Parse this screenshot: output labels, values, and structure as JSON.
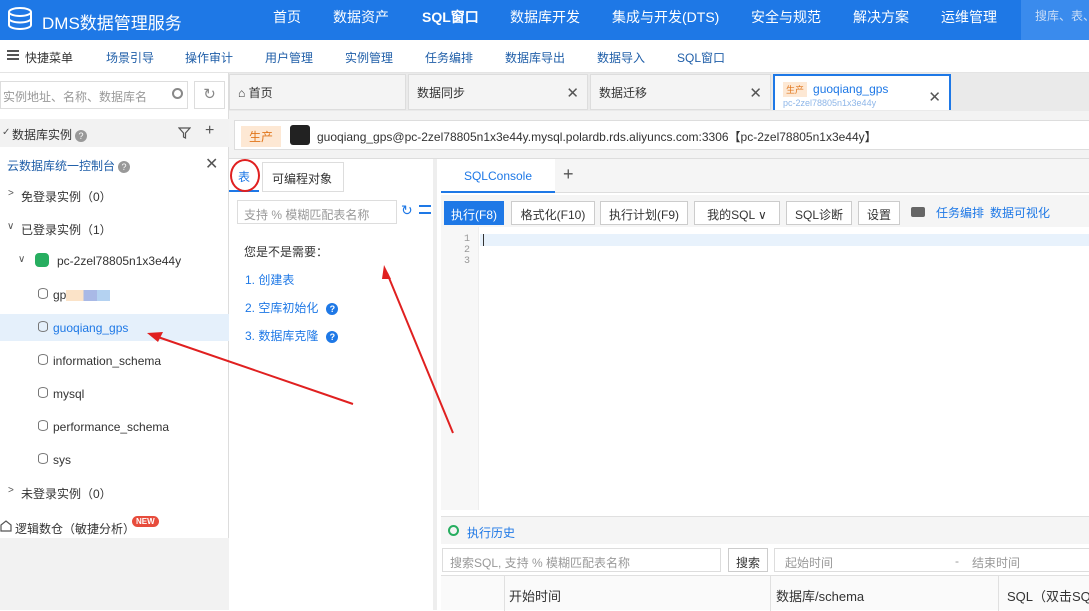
{
  "app": {
    "title": "DMS数据管理服务"
  },
  "topnav": {
    "items": [
      "首页",
      "数据资产",
      "SQL窗口",
      "数据库开发",
      "集成与开发(DTS)",
      "安全与规范",
      "解决方案",
      "运维管理"
    ],
    "active": "SQL窗口",
    "search_placeholder": "搜库、表、列"
  },
  "quickbar": {
    "label": "快捷菜单",
    "items": [
      "场景引导",
      "操作审计",
      "用户管理",
      "实例管理",
      "任务编排",
      "数据库导出",
      "数据导入",
      "SQL窗口"
    ]
  },
  "left": {
    "search_placeholder": "实例地址、名称、数据库名",
    "db_instances_label": "数据库实例",
    "console_link": "云数据库统一控制台",
    "no_login_group": "免登录实例（0）",
    "logged_group": "已登录实例（1）",
    "instance_name": "pc-2zel78805n1x3e44y",
    "databases": [
      "gp",
      "guoqiang_gps",
      "information_schema",
      "mysql",
      "performance_schema",
      "sys"
    ],
    "unlogged_group": "未登录实例（0）",
    "logic_db_label": "逻辑数仓（敏捷分析）",
    "new_badge": "NEW"
  },
  "tabs": [
    {
      "label": "首页"
    },
    {
      "label": "数据同步"
    },
    {
      "label": "数据迁移"
    },
    {
      "env": "生产",
      "label": "guoqiang_gps",
      "sub": "pc-2zel78805n1x3e44y"
    }
  ],
  "connection": {
    "env": "生产",
    "text": "guoqiang_gps@pc-2zel78805n1x3e44y.mysql.polardb.rds.aliyuncs.com:3306【pc-2zel78805n1x3e44y】"
  },
  "objects": {
    "tab_table": "表",
    "tab_programmable": "可编程对象",
    "search_placeholder": "支持 % 模糊匹配表名称",
    "suggest_title": "您是不是需要：",
    "suggestions": [
      "1. 创建表",
      "2. 空库初始化",
      "3. 数据库克隆"
    ]
  },
  "console": {
    "tab": "SQLConsole",
    "buttons": {
      "execute": "执行(F8)",
      "format": "格式化(F10)",
      "plan": "执行计划(F9)",
      "my_sql": "我的SQL",
      "diagnose": "SQL诊断",
      "settings": "设置"
    },
    "links": [
      "任务编排",
      "数据可视化"
    ],
    "line_numbers": [
      "1",
      "2",
      "3"
    ]
  },
  "history": {
    "label": "执行历史",
    "search_placeholder": "搜索SQL, 支持 % 模糊匹配表名称",
    "search_button": "搜索",
    "start_placeholder": "起始时间",
    "separator": "-",
    "end_placeholder": "结束时间",
    "columns": [
      "开始时间",
      "数据库/schema",
      "SQL（双击SQL"
    ]
  },
  "colors": {
    "primary": "#1e78e6",
    "annotation": "#e02020",
    "env_badge": "#e0751a"
  }
}
